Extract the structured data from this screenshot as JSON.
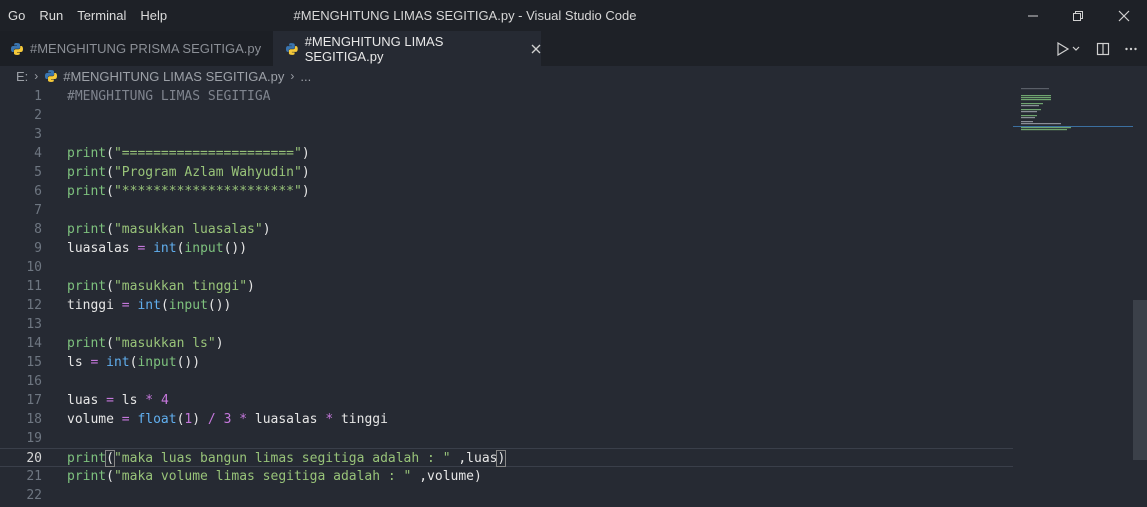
{
  "titlebar": {
    "menus": [
      "Go",
      "Run",
      "Terminal",
      "Help"
    ],
    "window_title": "#MENGHITUNG LIMAS SEGITIGA.py - Visual Studio Code"
  },
  "tabs": [
    {
      "label": "#MENGHITUNG PRISMA SEGITIGA.py",
      "active": false
    },
    {
      "label": "#MENGHITUNG LIMAS SEGITIGA.py",
      "active": true
    }
  ],
  "breadcrumb": {
    "drive": "E:",
    "file": "#MENGHITUNG LIMAS SEGITIGA.py",
    "more": "..."
  },
  "editor": {
    "current_line": 20,
    "lines": [
      {
        "n": "1",
        "tokens": [
          [
            "c-comment",
            "#MENGHITUNG LIMAS SEGITIGA"
          ]
        ]
      },
      {
        "n": "2",
        "tokens": []
      },
      {
        "n": "3",
        "tokens": []
      },
      {
        "n": "4",
        "tokens": [
          [
            "c-fn",
            "print"
          ],
          [
            "c-punc",
            "("
          ],
          [
            "c-str",
            "\"======================\""
          ],
          [
            "c-punc",
            ")"
          ]
        ]
      },
      {
        "n": "5",
        "tokens": [
          [
            "c-fn",
            "print"
          ],
          [
            "c-punc",
            "("
          ],
          [
            "c-str",
            "\"Program Azlam Wahyudin\""
          ],
          [
            "c-punc",
            ")"
          ]
        ]
      },
      {
        "n": "6",
        "tokens": [
          [
            "c-fn",
            "print"
          ],
          [
            "c-punc",
            "("
          ],
          [
            "c-str",
            "\"**********************\""
          ],
          [
            "c-punc",
            ")"
          ]
        ]
      },
      {
        "n": "7",
        "tokens": []
      },
      {
        "n": "8",
        "tokens": [
          [
            "c-fn",
            "print"
          ],
          [
            "c-punc",
            "("
          ],
          [
            "c-str",
            "\"masukkan luasalas\""
          ],
          [
            "c-punc",
            ")"
          ]
        ]
      },
      {
        "n": "9",
        "tokens": [
          [
            "c-var",
            "luasalas "
          ],
          [
            "c-op",
            "="
          ],
          [
            "c-var",
            " "
          ],
          [
            "c-builtin",
            "int"
          ],
          [
            "c-punc",
            "("
          ],
          [
            "c-fn",
            "input"
          ],
          [
            "c-punc",
            "())"
          ]
        ]
      },
      {
        "n": "10",
        "tokens": []
      },
      {
        "n": "11",
        "tokens": [
          [
            "c-fn",
            "print"
          ],
          [
            "c-punc",
            "("
          ],
          [
            "c-str",
            "\"masukkan tinggi\""
          ],
          [
            "c-punc",
            ")"
          ]
        ]
      },
      {
        "n": "12",
        "tokens": [
          [
            "c-var",
            "tinggi "
          ],
          [
            "c-op",
            "="
          ],
          [
            "c-var",
            " "
          ],
          [
            "c-builtin",
            "int"
          ],
          [
            "c-punc",
            "("
          ],
          [
            "c-fn",
            "input"
          ],
          [
            "c-punc",
            "())"
          ]
        ]
      },
      {
        "n": "13",
        "tokens": []
      },
      {
        "n": "14",
        "tokens": [
          [
            "c-fn",
            "print"
          ],
          [
            "c-punc",
            "("
          ],
          [
            "c-str",
            "\"masukkan ls\""
          ],
          [
            "c-punc",
            ")"
          ]
        ]
      },
      {
        "n": "15",
        "tokens": [
          [
            "c-var",
            "ls "
          ],
          [
            "c-op",
            "="
          ],
          [
            "c-var",
            " "
          ],
          [
            "c-builtin",
            "int"
          ],
          [
            "c-punc",
            "("
          ],
          [
            "c-fn",
            "input"
          ],
          [
            "c-punc",
            "())"
          ]
        ]
      },
      {
        "n": "16",
        "tokens": []
      },
      {
        "n": "17",
        "tokens": [
          [
            "c-var",
            "luas "
          ],
          [
            "c-op",
            "="
          ],
          [
            "c-var",
            " ls "
          ],
          [
            "c-op",
            "*"
          ],
          [
            "c-var",
            " "
          ],
          [
            "c-num",
            "4"
          ]
        ]
      },
      {
        "n": "18",
        "tokens": [
          [
            "c-var",
            "volume "
          ],
          [
            "c-op",
            "="
          ],
          [
            "c-var",
            " "
          ],
          [
            "c-builtin",
            "float"
          ],
          [
            "c-punc",
            "("
          ],
          [
            "c-num",
            "1"
          ],
          [
            "c-punc",
            ")"
          ],
          [
            "c-var",
            " "
          ],
          [
            "c-op",
            "/"
          ],
          [
            "c-var",
            " "
          ],
          [
            "c-num",
            "3"
          ],
          [
            "c-var",
            " "
          ],
          [
            "c-op",
            "*"
          ],
          [
            "c-var",
            " luasalas "
          ],
          [
            "c-op",
            "*"
          ],
          [
            "c-var",
            " tinggi"
          ]
        ]
      },
      {
        "n": "19",
        "tokens": []
      },
      {
        "n": "20",
        "tokens": [
          [
            "c-fn",
            "print"
          ],
          [
            "c-punc cursor-bracket",
            "("
          ],
          [
            "c-str",
            "\"maka luas bangun limas segitiga adalah : \""
          ],
          [
            "c-var",
            " ,luas"
          ],
          [
            "c-punc cursor-bracket",
            ")"
          ]
        ]
      },
      {
        "n": "21",
        "tokens": [
          [
            "c-fn",
            "print"
          ],
          [
            "c-punc",
            "("
          ],
          [
            "c-str",
            "\"maka volume limas segitiga adalah : \""
          ],
          [
            "c-var",
            " ,volume"
          ],
          [
            "c-punc",
            ")"
          ]
        ]
      },
      {
        "n": "22",
        "tokens": []
      }
    ]
  },
  "colors": {
    "background": "#262a33",
    "titlebar": "#1e2127",
    "python_blue": "#3a75b0",
    "python_yellow": "#f5c93a"
  }
}
